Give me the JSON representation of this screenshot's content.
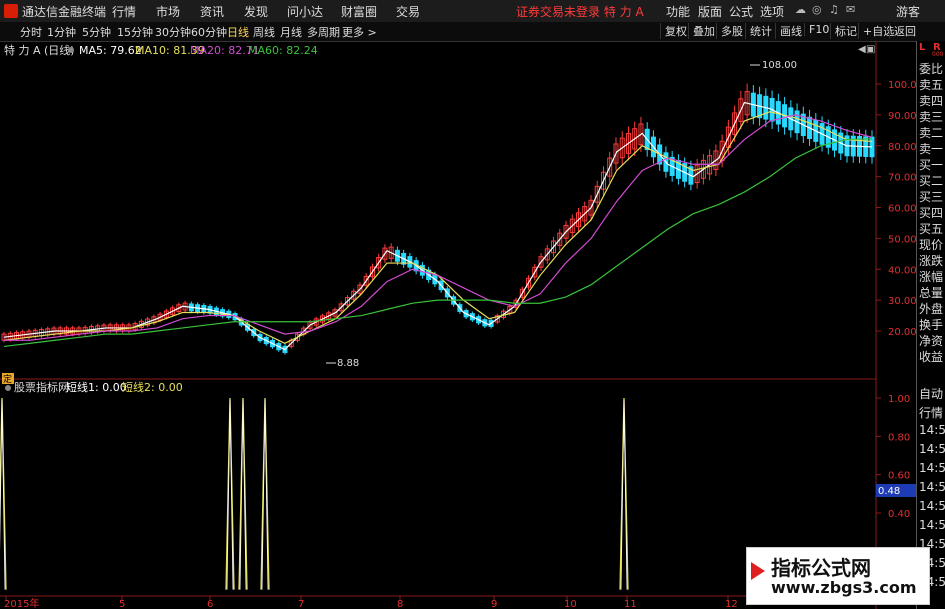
{
  "menubar": {
    "app_title": "通达信金融终端",
    "items": [
      "行情",
      "市场",
      "资讯",
      "发现",
      "问小达",
      "财富圈",
      "交易"
    ],
    "login_status": "证券交易未登录  特 力 A",
    "right_items": [
      "功能",
      "版面",
      "公式",
      "选项"
    ],
    "guest": "游客"
  },
  "toolbar": {
    "periods": [
      "分时",
      "1分钟",
      "5分钟",
      "15分钟",
      "30分钟",
      "60分钟",
      "日线",
      "周线",
      "月线",
      "多周期",
      "更多 >"
    ],
    "active_period": "日线",
    "right_buttons": [
      "复权",
      "叠加",
      "多股",
      "统计",
      "画线",
      "F10",
      "标记",
      "+自选",
      "返回"
    ]
  },
  "main_chart": {
    "stock_label": "特 力 A  (日线)",
    "ma_labels": [
      {
        "text": "MA5: 79.62",
        "color": "#ffffff"
      },
      {
        "text": "MA10: 81.39",
        "color": "#e8e05a"
      },
      {
        "text": "MA20: 82.71",
        "color": "#d24bd2"
      },
      {
        "text": "MA60: 82.24",
        "color": "#39c239"
      }
    ],
    "high_annotation": "108.00",
    "low_annotation": "8.88",
    "y_ticks": [
      "100.0",
      "90.00",
      "80.00",
      "70.00",
      "60.00",
      "50.00",
      "40.00",
      "30.00",
      "20.00"
    ],
    "ding_marker": "定"
  },
  "indicator_panel": {
    "name": "股票指标网",
    "line1_label": "短线1: 0.00",
    "line2_label": "短线2: 0.00",
    "y_ticks": [
      "1.00",
      "0.80",
      "0.60",
      "0.40"
    ],
    "highlight_value": "0.48"
  },
  "x_axis": {
    "labels": [
      "2015年",
      "5",
      "6",
      "7",
      "8",
      "9",
      "10",
      "11",
      "12"
    ]
  },
  "right_panel": {
    "top_chars": [
      "L",
      "R"
    ],
    "top_sub": "000",
    "rows": [
      "委比",
      "卖五",
      "卖四",
      "卖三",
      "卖二",
      "卖一",
      "买一",
      "买二",
      "买三",
      "买四",
      "买五",
      "现价",
      "涨跌",
      "涨幅",
      "总量",
      "外盘",
      "换手",
      "净资",
      "收益"
    ],
    "lower_rows": [
      "自动",
      "行情",
      "14:50",
      "14:50",
      "14:50",
      "14:50",
      "14:50",
      "14:50",
      "14:50",
      "14:50",
      "14:50"
    ]
  },
  "watermark": {
    "title": "指标公式网",
    "url": "www.zbgs3.com"
  },
  "chart_data": [
    {
      "type": "candlestick",
      "title": "特 力 A (日线)",
      "x_labels": [
        "2015年",
        "5",
        "6",
        "7",
        "8",
        "9",
        "10",
        "11",
        "12"
      ],
      "ylim": [
        10,
        110
      ],
      "series": [
        {
          "name": "MA5",
          "values": [
            18,
            19,
            20,
            20,
            21,
            21,
            24,
            28,
            27,
            25,
            18,
            14,
            22,
            26,
            34,
            46,
            42,
            36,
            26,
            22,
            28,
            42,
            52,
            60,
            78,
            84,
            74,
            70,
            76,
            94,
            92,
            88,
            84,
            80,
            79.62
          ]
        },
        {
          "name": "MA10",
          "values": [
            17,
            18,
            19,
            20,
            20,
            21,
            23,
            26,
            26,
            25,
            20,
            16,
            20,
            24,
            32,
            42,
            42,
            38,
            30,
            24,
            26,
            38,
            48,
            56,
            72,
            80,
            76,
            72,
            74,
            88,
            91,
            89,
            86,
            82,
            81.39
          ]
        },
        {
          "name": "MA20",
          "values": [
            17,
            17,
            18,
            19,
            20,
            20,
            21,
            24,
            25,
            25,
            22,
            19,
            20,
            23,
            28,
            36,
            40,
            38,
            34,
            30,
            28,
            32,
            42,
            50,
            62,
            72,
            76,
            74,
            74,
            82,
            88,
            90,
            88,
            85,
            82.71
          ]
        },
        {
          "name": "MA60",
          "values": [
            15,
            16,
            17,
            18,
            19,
            19,
            20,
            21,
            22,
            23,
            23,
            23,
            23,
            24,
            25,
            27,
            29,
            30,
            30,
            30,
            29,
            29,
            31,
            35,
            41,
            47,
            53,
            58,
            61,
            65,
            70,
            76,
            80,
            82,
            82.24
          ]
        }
      ],
      "annotations": [
        {
          "text": "108.00",
          "type": "high"
        },
        {
          "text": "8.88",
          "type": "low"
        }
      ]
    },
    {
      "type": "line",
      "title": "股票指标网",
      "ylim": [
        0,
        1.1
      ],
      "series": [
        {
          "name": "短线1",
          "values": [
            1,
            0,
            0,
            0,
            0,
            0,
            1,
            1,
            1,
            0,
            0,
            0,
            0,
            0,
            0,
            0,
            0,
            0,
            0,
            0,
            0,
            0,
            0,
            0,
            0,
            1,
            0,
            0,
            0,
            0,
            0,
            0,
            0,
            0,
            0
          ]
        },
        {
          "name": "短线2",
          "values": [
            1,
            0,
            0,
            0,
            0,
            0,
            1,
            1,
            1,
            0,
            0,
            0,
            0,
            0,
            0,
            0,
            0,
            0,
            0,
            0,
            0,
            0,
            0,
            0,
            0,
            1,
            0,
            0,
            0,
            0,
            0,
            0,
            0,
            0,
            0
          ]
        }
      ]
    }
  ]
}
